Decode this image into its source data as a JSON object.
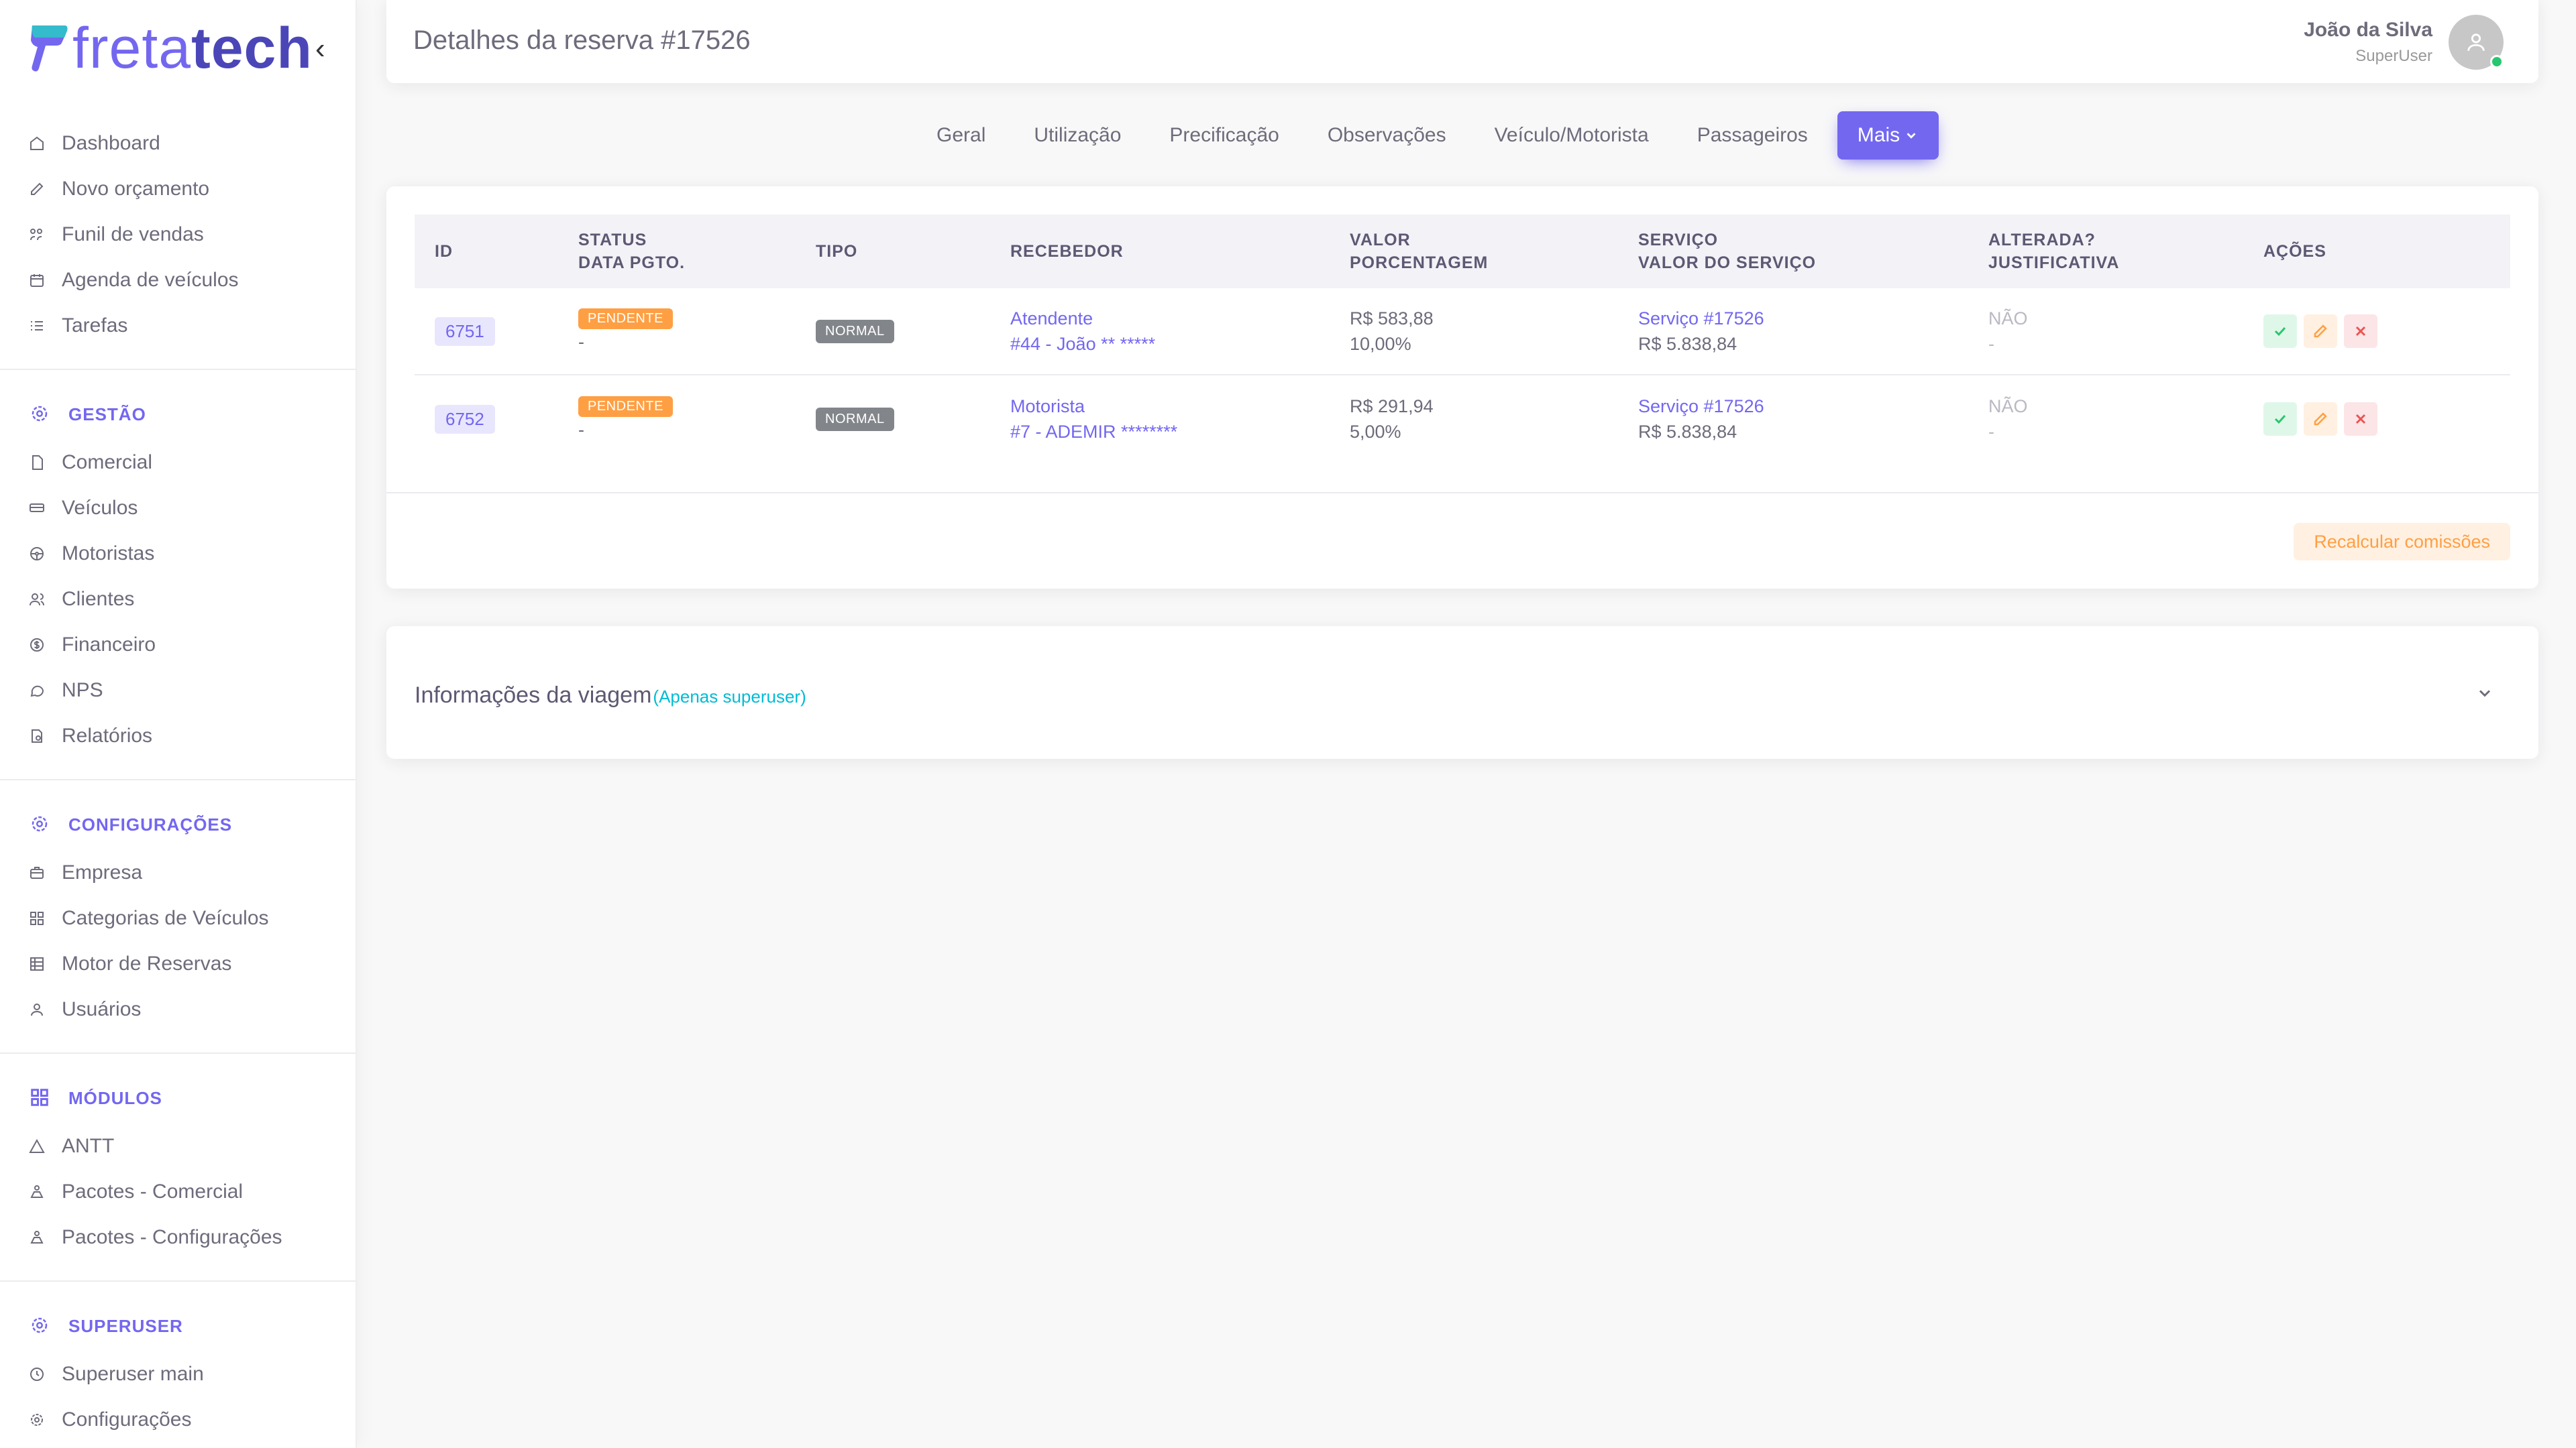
{
  "brand": {
    "light": "freta",
    "bold": "tech"
  },
  "sidebar": {
    "main": [
      {
        "label": "Dashboard",
        "icon": "home-icon"
      },
      {
        "label": "Novo orçamento",
        "icon": "edit-icon"
      },
      {
        "label": "Funil de vendas",
        "icon": "funnel-icon"
      },
      {
        "label": "Agenda de veículos",
        "icon": "calendar-icon"
      },
      {
        "label": "Tarefas",
        "icon": "list-icon"
      }
    ],
    "gestao": {
      "header": "GESTÃO",
      "items": [
        {
          "label": "Comercial",
          "icon": "file-icon"
        },
        {
          "label": "Veículos",
          "icon": "bus-icon"
        },
        {
          "label": "Motoristas",
          "icon": "steering-wheel-icon"
        },
        {
          "label": "Clientes",
          "icon": "users-icon"
        },
        {
          "label": "Financeiro",
          "icon": "dollar-icon"
        },
        {
          "label": "NPS",
          "icon": "chat-icon"
        },
        {
          "label": "Relatórios",
          "icon": "report-icon"
        }
      ]
    },
    "config": {
      "header": "CONFIGURAÇÕES",
      "items": [
        {
          "label": "Empresa",
          "icon": "briefcase-icon"
        },
        {
          "label": "Categorias de Veículos",
          "icon": "grid-icon"
        },
        {
          "label": "Motor de Reservas",
          "icon": "table-icon"
        },
        {
          "label": "Usuários",
          "icon": "user-icon"
        }
      ]
    },
    "modulos": {
      "header": "MÓDULOS",
      "items": [
        {
          "label": "ANTT",
          "icon": "triangle-icon"
        },
        {
          "label": "Pacotes - Comercial",
          "icon": "package-icon"
        },
        {
          "label": "Pacotes - Configurações",
          "icon": "package-icon"
        }
      ]
    },
    "superuser": {
      "header": "SUPERUSER",
      "items": [
        {
          "label": "Superuser main",
          "icon": "clock-icon"
        },
        {
          "label": "Configurações",
          "icon": "gear-icon"
        }
      ]
    }
  },
  "header": {
    "title": "Detalhes da reserva #17526",
    "user_name": "João da Silva",
    "user_role": "SuperUser"
  },
  "tabs": [
    "Geral",
    "Utilização",
    "Precificação",
    "Observações",
    "Veículo/Motorista",
    "Passageiros",
    "Mais"
  ],
  "table": {
    "headers": {
      "id": "ID",
      "status": "STATUS",
      "data_pgto": "DATA PGTO.",
      "tipo": "TIPO",
      "recebedor": "RECEBEDOR",
      "valor": "VALOR",
      "porcentagem": "PORCENTAGEM",
      "servico": "SERVIÇO",
      "valor_servico": "VALOR DO SERVIÇO",
      "alterada": "ALTERADA?",
      "justificativa": "JUSTIFICATIVA",
      "acoes": "AÇÕES"
    },
    "rows": [
      {
        "id": "6751",
        "status": "PENDENTE",
        "data_pgto": "-",
        "tipo": "NORMAL",
        "recebedor": "Atendente",
        "recebedor_detail": "#44 - João ** *****",
        "valor": "R$ 583,88",
        "porcentagem": "10,00%",
        "servico": "Serviço #17526",
        "valor_servico": "R$ 5.838,84",
        "alterada": "NÃO",
        "justificativa": "-"
      },
      {
        "id": "6752",
        "status": "PENDENTE",
        "data_pgto": "-",
        "tipo": "NORMAL",
        "recebedor": "Motorista",
        "recebedor_detail": "#7 - ADEMIR ********",
        "valor": "R$ 291,94",
        "porcentagem": "5,00%",
        "servico": "Serviço #17526",
        "valor_servico": "R$ 5.838,84",
        "alterada": "NÃO",
        "justificativa": "-"
      }
    ],
    "recalc_label": "Recalcular comissões"
  },
  "trip": {
    "title": "Informações da viagem",
    "subtitle": "(Apenas superuser)"
  },
  "colors": {
    "primary": "#7367f0",
    "warning": "#ff9f43",
    "success": "#28c76f",
    "danger": "#ea5455",
    "secondary": "#82868b"
  }
}
